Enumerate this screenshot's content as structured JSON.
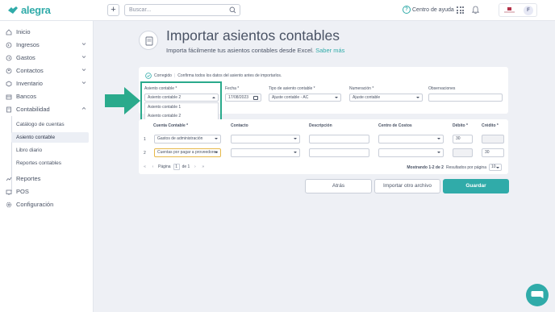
{
  "header": {
    "logo_text": "alegra",
    "plus_label": "+",
    "search_placeholder": "Buscar...",
    "help_label": "Centro de ayuda",
    "avatar_letter": "F"
  },
  "sidebar": {
    "items": [
      {
        "label": "Inicio",
        "icon": "home-icon"
      },
      {
        "label": "Ingresos",
        "icon": "income-icon"
      },
      {
        "label": "Gastos",
        "icon": "expenses-icon"
      },
      {
        "label": "Contactos",
        "icon": "contacts-icon"
      },
      {
        "label": "Inventario",
        "icon": "inventory-icon"
      },
      {
        "label": "Bancos",
        "icon": "bank-icon"
      },
      {
        "label": "Contabilidad",
        "icon": "accounting-icon"
      }
    ],
    "subitems": [
      {
        "label": "Catálogo de cuentas"
      },
      {
        "label": "Asiento contable"
      },
      {
        "label": "Libro diario"
      },
      {
        "label": "Reportes contables"
      }
    ],
    "bottom_items": [
      {
        "label": "Reportes",
        "icon": "reports-icon"
      },
      {
        "label": "POS",
        "icon": "pos-icon"
      },
      {
        "label": "Configuración",
        "icon": "settings-icon"
      }
    ]
  },
  "page": {
    "title": "Importar asientos contables",
    "subtitle": "Importa fácilmente tus asientos contables desde Excel.",
    "subtitle_link": "Saber más"
  },
  "form": {
    "status_label": "Corregido",
    "status_sep": "|",
    "status_note": "Confirma todos los datos del asiento antes de importarlos.",
    "asiento_label": "Asiento contable *",
    "asiento_value": "Asiento contable 2",
    "asiento_options": [
      "Asiento contable 1",
      "Asiento contable 2"
    ],
    "fecha_label": "Fecha *",
    "fecha_value": "17/08/2023",
    "tipo_label": "Tipo de asiento contable *",
    "tipo_value": "Ajuste contable - AC",
    "numeracion_label": "Numeración *",
    "numeracion_value": "Ajuste contable",
    "observaciones_label": "Observaciones",
    "observaciones_value": ""
  },
  "table": {
    "headers": {
      "cuenta": "Cuenta Contable *",
      "contacto": "Contacto",
      "descripcion": "Descripción",
      "centro": "Centro de Costos",
      "debito": "Débito *",
      "credito": "Crédito *"
    },
    "rows": [
      {
        "num": "1",
        "cuenta": "Gastos de administración",
        "contacto": "",
        "descripcion": "",
        "centro": "",
        "debito": "30",
        "credito": ""
      },
      {
        "num": "2",
        "cuenta": "Cuentas por pagar a proveedores",
        "contacto": "",
        "descripcion": "",
        "centro": "",
        "debito": "",
        "credito": "30"
      }
    ],
    "pager": {
      "first": "«",
      "prev": "‹",
      "page_label": "Página",
      "page_value": "1",
      "of_label": "de 1",
      "next": "›",
      "last": "»",
      "showing": "Mostrando 1-2 de 2",
      "per_page_label": "Resultados por página",
      "per_page_value": "10"
    }
  },
  "actions": {
    "back": "Atrás",
    "import_other": "Importar otro archivo",
    "save": "Guardar"
  },
  "colors": {
    "brand": "#30aba9",
    "arrow": "#2aaa8c"
  }
}
